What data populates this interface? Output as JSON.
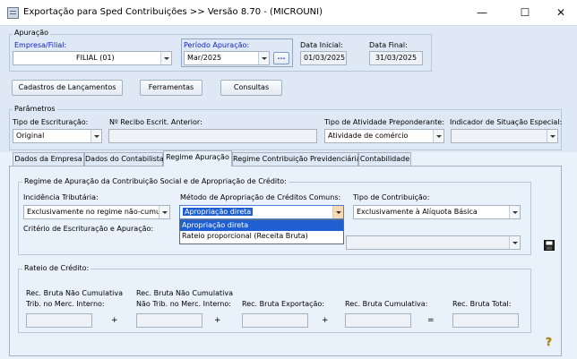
{
  "window": {
    "title": "Exportação para Sped Contribuições >> Versão 8.70 - (MICROUNI)",
    "minimize": "—",
    "maximize": "☐",
    "close": "✕"
  },
  "apuracao": {
    "legend": "Apuração",
    "empresa_label": "Empresa/Filial:",
    "empresa_value": "FILIAL (01)",
    "periodo_label": "Período Apuração:",
    "periodo_value": "Mar/2025",
    "periodo_button": "...",
    "data_inicial_label": "Data Inicial:",
    "data_inicial": "01/03/2025",
    "data_final_label": "Data Final:",
    "data_final": "31/03/2025"
  },
  "toolbar": {
    "cadastros": "Cadastros de Lançamentos",
    "ferramentas": "Ferramentas",
    "consultas": "Consultas"
  },
  "parametros": {
    "legend": "Parâmetros",
    "tipo_escrituracao_label": "Tipo de Escrituração:",
    "tipo_escrituracao_value": "Original",
    "recibo_label": "Nº Recibo Escrit. Anterior:",
    "recibo_value": "",
    "atividade_label": "Tipo de Atividade Preponderante:",
    "atividade_value": "Atividade de comércio",
    "indicador_label": "Indicador de Situação Especial:",
    "indicador_value": ""
  },
  "tabs": [
    {
      "label": "Dados da Empresa"
    },
    {
      "label": "Dados do Contabilista"
    },
    {
      "label": "Regime Apuração"
    },
    {
      "label": "Regime Contribuição Previdenciária"
    },
    {
      "label": "Contabilidade"
    }
  ],
  "regime": {
    "legend": "Regime de Apuração da Contribuição Social e de Apropriação de Crédito:",
    "incidencia_label": "Incidência Tributária:",
    "incidencia_value": "Exclusivamente no regime não-cumula",
    "metodo_label": "Método de Apropriação de Créditos Comuns:",
    "metodo_value": "Apropriação direta",
    "metodo_options": [
      "Apropriação direta",
      "Rateio proporcional (Receita Bruta)"
    ],
    "tipo_contrib_label": "Tipo de Contribuição:",
    "tipo_contrib_value": "Exclusivamente à Alíquota Básica",
    "criterio_label": "Critério de Escrituração e Apuração:",
    "criterio_value": ""
  },
  "rateio": {
    "legend": "Rateio de Crédito:",
    "col1_line1": "Rec. Bruta Não Cumulativa",
    "col1_line2": "Trib. no Merc. Interno:",
    "col2_line1": "Rec. Bruta Não Cumulativa",
    "col2_line2": "Não Trib. no Merc. Interno:",
    "col3": "Rec. Bruta Exportação:",
    "col4": "Rec. Bruta Cumulativa:",
    "col5": "Rec. Bruta Total:",
    "op1": "+",
    "op2": "+",
    "op3": "+",
    "op4": "="
  },
  "icons": {
    "save": "save-icon",
    "help": "help-icon",
    "save_glyph": "💾",
    "help_glyph": "?"
  }
}
